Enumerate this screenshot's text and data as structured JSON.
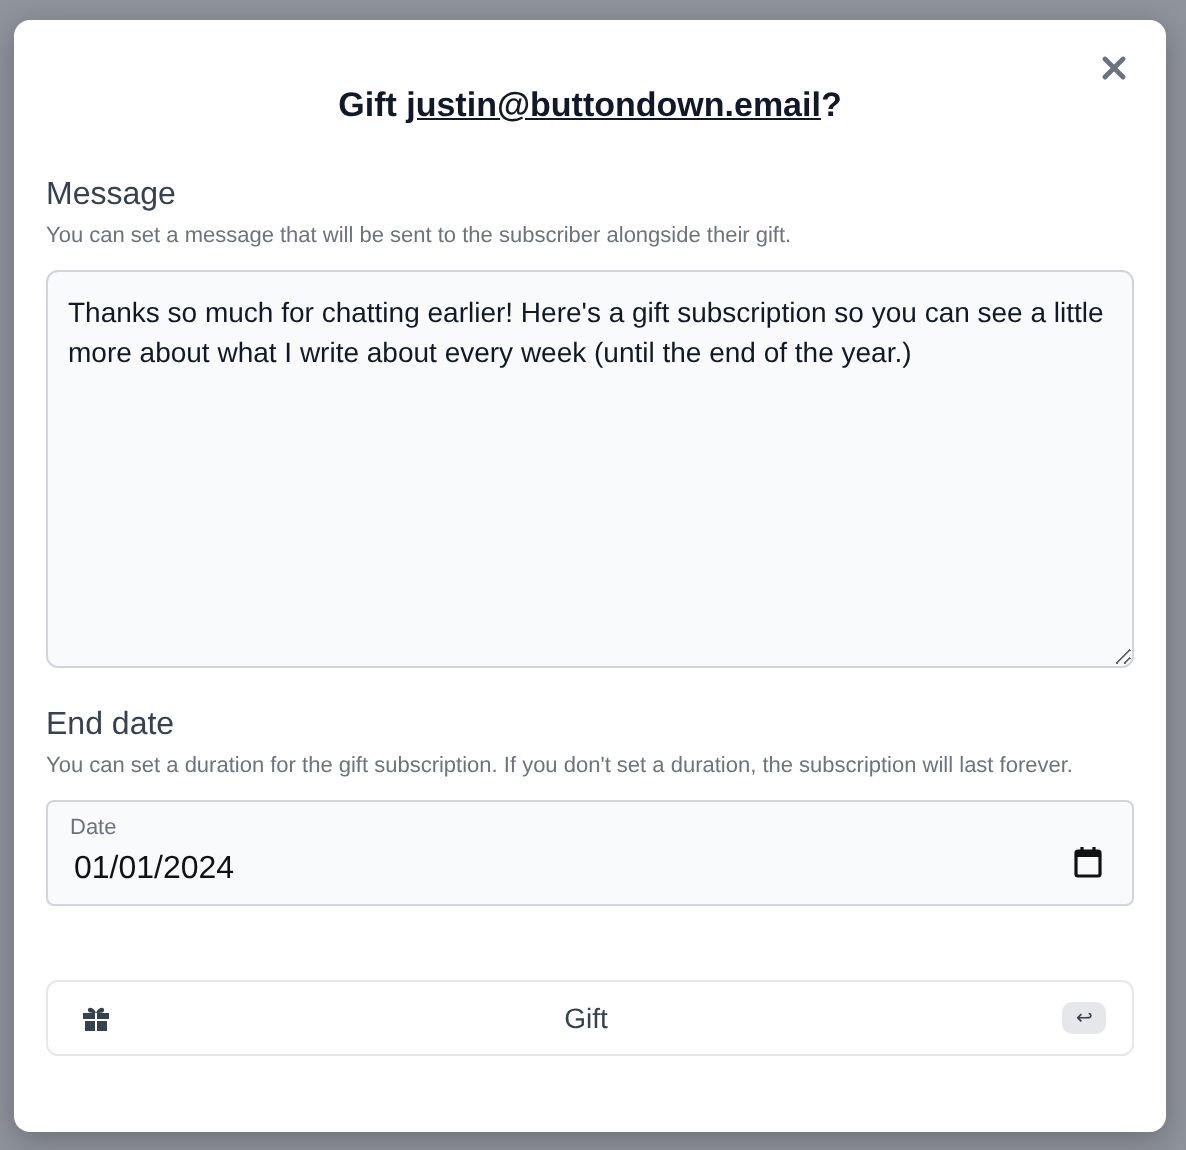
{
  "dialog": {
    "title_prefix": "Gift ",
    "title_link": "justin@buttondown.email",
    "title_suffix": "?"
  },
  "message": {
    "label": "Message",
    "help": "You can set a message that will be sent to the subscriber alongside their gift.",
    "value": "Thanks so much for chatting earlier! Here's a gift subscription so you can see a little more about what I write about every week (until the end of the year.)"
  },
  "end_date": {
    "label": "End date",
    "help": "You can set a duration for the gift subscription. If you don't set a duration, the subscription will last forever.",
    "field_label": "Date",
    "value": "01/01/2024"
  },
  "submit": {
    "label": "Gift",
    "shortcut": "↩"
  }
}
